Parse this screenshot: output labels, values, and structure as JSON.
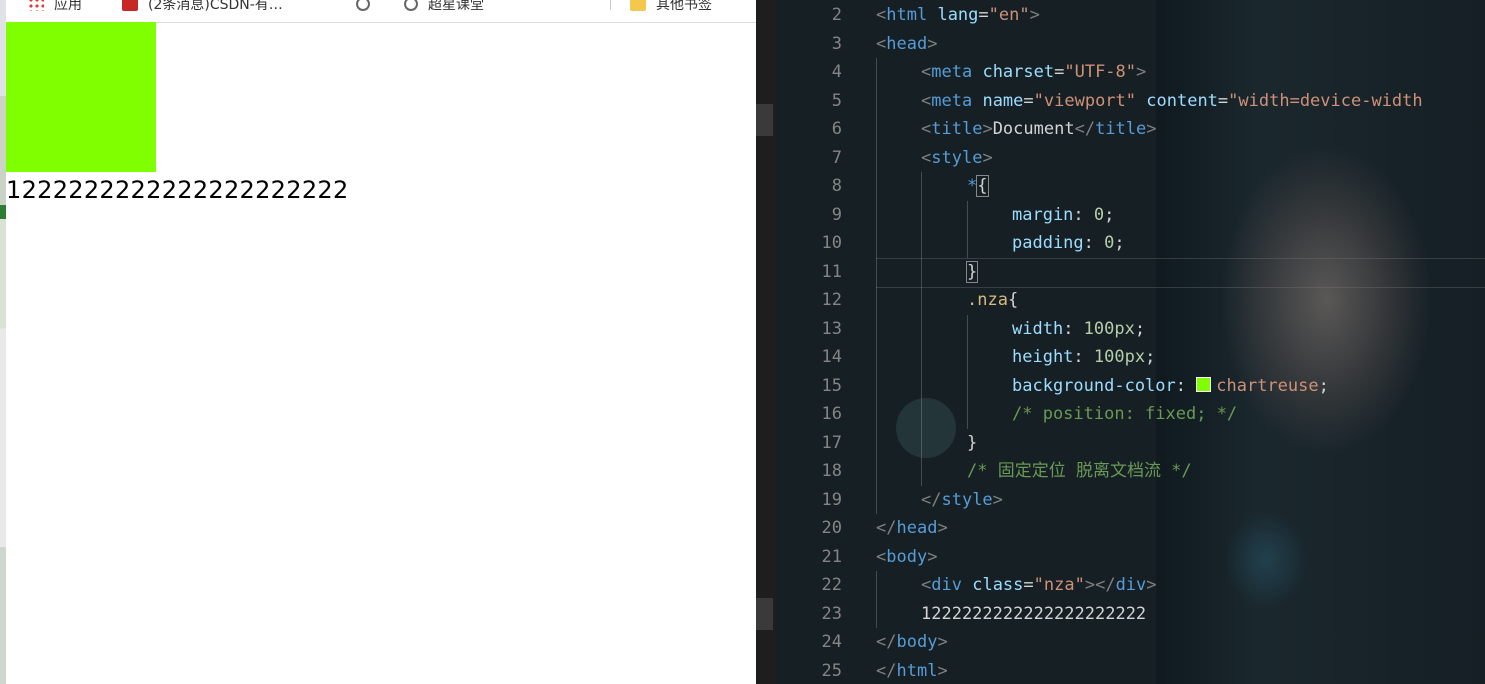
{
  "bookmarks": [
    {
      "label": "应用",
      "icon": "apps-grid-icon"
    },
    {
      "label": "(2条消息)CSDN-有…",
      "icon": "csdn-logo-icon"
    },
    {
      "label": "",
      "icon": "globe-icon"
    },
    {
      "label": "超星课堂",
      "icon": "globe-icon"
    },
    {
      "label": "其他书签",
      "icon": "folder-icon"
    }
  ],
  "browser_page": {
    "box_color": "#7fff00",
    "text": "1222222222222222222222"
  },
  "editor": {
    "line_numbers": [
      "2",
      "3",
      "4",
      "5",
      "6",
      "7",
      "8",
      "9",
      "10",
      "11",
      "12",
      "13",
      "14",
      "15",
      "16",
      "17",
      "18",
      "19",
      "20",
      "21",
      "22",
      "23",
      "24",
      "25"
    ],
    "code": {
      "l2": {
        "tag": "html",
        "attr": "lang",
        "val": "\"en\""
      },
      "l3": {
        "tag": "head"
      },
      "l4": {
        "tag": "meta",
        "attr": "charset",
        "val": "\"UTF-8\""
      },
      "l5": {
        "tag": "meta",
        "attr1": "name",
        "val1": "\"viewport\"",
        "attr2": "content",
        "val2": "\"width=device-width"
      },
      "l6": {
        "tag": "title",
        "text": "Document"
      },
      "l7": {
        "tag": "style"
      },
      "l8": {
        "selector": "*"
      },
      "l9": {
        "prop": "margin",
        "val": "0"
      },
      "l10": {
        "prop": "padding",
        "val": "0"
      },
      "l12": {
        "selector": ".nza"
      },
      "l13": {
        "prop": "width",
        "val": "100px"
      },
      "l14": {
        "prop": "height",
        "val": "100px"
      },
      "l15": {
        "prop": "background-color",
        "val": "chartreuse"
      },
      "l16": {
        "comment": "/* position: fixed; */"
      },
      "l18": {
        "comment": "/* 固定定位 脱离文档流 */"
      },
      "l19": {
        "tag": "style"
      },
      "l20": {
        "tag": "head"
      },
      "l21": {
        "tag": "body"
      },
      "l22": {
        "tag": "div",
        "attr": "class",
        "val": "\"nza\""
      },
      "l23": {
        "text": "1222222222222222222222"
      },
      "l24": {
        "tag": "body"
      },
      "l25": {
        "tag": "html"
      }
    }
  }
}
